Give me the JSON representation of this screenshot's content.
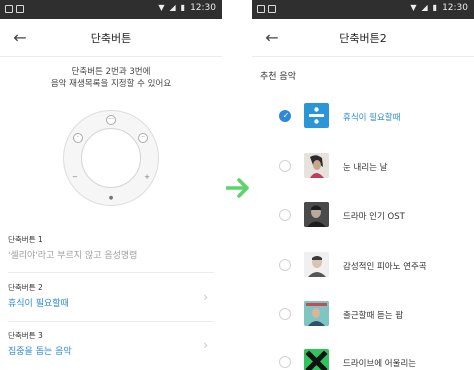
{
  "status_bar": {
    "time": "12:30",
    "icons": [
      "wifi-icon",
      "signal-icon",
      "battery-icon"
    ]
  },
  "screen1": {
    "title": "단축버튼",
    "description_line1": "단축버튼 2번과 3번에",
    "description_line2": "음악 재생목록을 지정할 수 있어요",
    "dial_marks": {
      "minus": "−",
      "plus": "+"
    },
    "settings": [
      {
        "label": "단축버튼 1",
        "value": "'셀리야'라고 부르지 않고 음성명령"
      },
      {
        "label": "단축버튼 2",
        "value": "휴식이 필요할때"
      },
      {
        "label": "단축버튼 3",
        "value": "집중을 돕는 음악"
      }
    ]
  },
  "screen2": {
    "title": "단축버튼2",
    "section_title": "추천 음악",
    "tracks": [
      {
        "title": "휴식이 필요할때",
        "selected": true
      },
      {
        "title": "눈 내리는 날",
        "selected": false
      },
      {
        "title": "드라마 인기 OST",
        "selected": false
      },
      {
        "title": "감성적인 피아노 연주곡",
        "selected": false
      },
      {
        "title": "출근할때 듣는 팝",
        "selected": false
      },
      {
        "title": "드라이브에 어울리는",
        "selected": false
      }
    ]
  },
  "colors": {
    "accent": "#2a8ad9",
    "arrow": "#5fd36b",
    "status_bar": "#2f2f2f"
  }
}
